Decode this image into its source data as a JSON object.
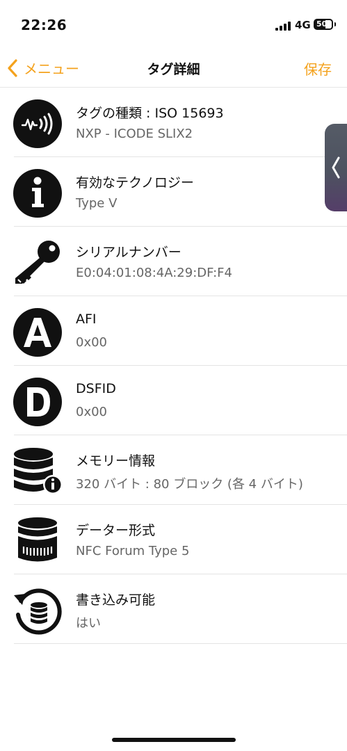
{
  "status": {
    "time": "22:26",
    "network": "4G",
    "battery": "50"
  },
  "nav": {
    "back_label": "メニュー",
    "title": "タグ詳細",
    "save_label": "保存"
  },
  "rows": [
    {
      "title": "タグの種類 : ISO 15693",
      "sub": "NXP - ICODE SLIX2",
      "icon": "nfc-icon"
    },
    {
      "title": "有効なテクノロジー",
      "sub": "Type V",
      "icon": "info-icon"
    },
    {
      "title": "シリアルナンバー",
      "sub": "E0:04:01:08:4A:29:DF:F4",
      "icon": "key-icon"
    },
    {
      "title": "AFI",
      "sub": "0x00",
      "icon": "letter-a-icon"
    },
    {
      "title": "DSFID",
      "sub": "0x00",
      "icon": "letter-d-icon"
    },
    {
      "title": "メモリー情報",
      "sub": "320 バイト : 80 ブロック (各 4 バイト)",
      "icon": "database-info-icon"
    },
    {
      "title": "データー形式",
      "sub": "NFC Forum Type 5",
      "icon": "database-format-icon"
    },
    {
      "title": "書き込み可能",
      "sub": "はい",
      "icon": "database-refresh-icon"
    }
  ],
  "colors": {
    "accent": "#f4a21d",
    "icon": "#111111",
    "subtext": "#666666"
  }
}
